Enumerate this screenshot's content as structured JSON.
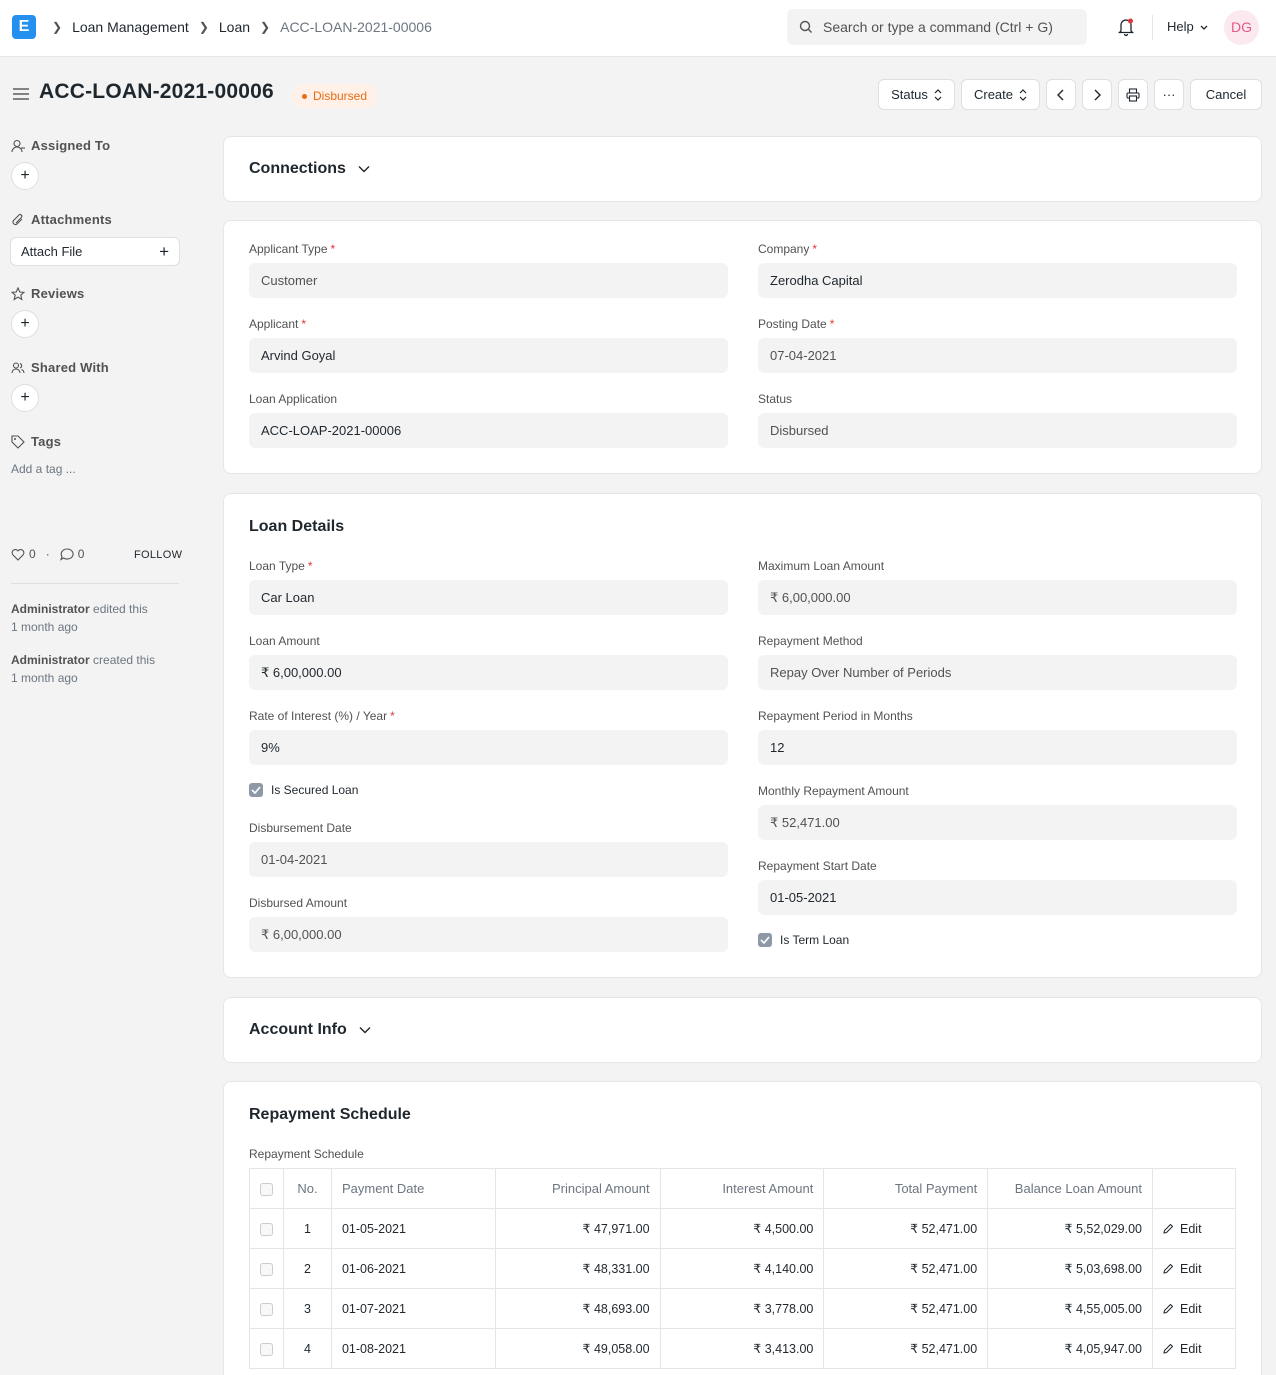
{
  "topbar": {
    "logo": "E",
    "breadcrumbs": [
      "Loan Management",
      "Loan",
      "ACC-LOAN-2021-00006"
    ],
    "search_placeholder": "Search or type a command (Ctrl + G)",
    "help_label": "Help",
    "avatar_initials": "DG"
  },
  "page": {
    "title": "ACC-LOAN-2021-00006",
    "status_badge": "Disbursed",
    "buttons": {
      "status": "Status",
      "create": "Create",
      "more": "···",
      "cancel": "Cancel"
    }
  },
  "sidebar": {
    "assigned_to": "Assigned To",
    "attachments": "Attachments",
    "attach_file": "Attach File",
    "reviews": "Reviews",
    "shared_with": "Shared With",
    "tags": "Tags",
    "add_tag": "Add a tag ...",
    "likes": "0",
    "comments": "0",
    "follow": "FOLLOW",
    "activity": [
      {
        "user": "Administrator",
        "action": "edited this",
        "time": "1 month ago"
      },
      {
        "user": "Administrator",
        "action": "created this",
        "time": "1 month ago"
      }
    ]
  },
  "connections": {
    "title": "Connections"
  },
  "header_fields": {
    "applicant_type": {
      "label": "Applicant Type",
      "value": "Customer"
    },
    "company": {
      "label": "Company",
      "value": "Zerodha Capital"
    },
    "applicant": {
      "label": "Applicant",
      "value": "Arvind Goyal"
    },
    "posting_date": {
      "label": "Posting Date",
      "value": "07-04-2021"
    },
    "loan_application": {
      "label": "Loan Application",
      "value": "ACC-LOAP-2021-00006"
    },
    "status": {
      "label": "Status",
      "value": "Disbursed"
    }
  },
  "loan_details": {
    "title": "Loan Details",
    "loan_type": {
      "label": "Loan Type",
      "value": "Car Loan"
    },
    "loan_amount": {
      "label": "Loan Amount",
      "value": "₹ 6,00,000.00"
    },
    "rate_of_interest": {
      "label": "Rate of Interest (%) / Year",
      "value": "9%"
    },
    "is_secured": {
      "label": "Is Secured Loan",
      "checked": true
    },
    "disbursement_date": {
      "label": "Disbursement Date",
      "value": "01-04-2021"
    },
    "disbursed_amount": {
      "label": "Disbursed Amount",
      "value": "₹ 6,00,000.00"
    },
    "max_loan_amount": {
      "label": "Maximum Loan Amount",
      "value": "₹ 6,00,000.00"
    },
    "repayment_method": {
      "label": "Repayment Method",
      "value": "Repay Over Number of Periods"
    },
    "repayment_period": {
      "label": "Repayment Period in Months",
      "value": "12"
    },
    "monthly_repayment": {
      "label": "Monthly Repayment Amount",
      "value": "₹ 52,471.00"
    },
    "repayment_start": {
      "label": "Repayment Start Date",
      "value": "01-05-2021"
    },
    "is_term_loan": {
      "label": "Is Term Loan",
      "checked": true
    }
  },
  "account_info": {
    "title": "Account Info"
  },
  "repayment_schedule": {
    "title": "Repayment Schedule",
    "table_label": "Repayment Schedule",
    "columns": [
      "No.",
      "Payment Date",
      "Principal Amount",
      "Interest Amount",
      "Total Payment",
      "Balance Loan Amount"
    ],
    "edit_label": "Edit",
    "rows": [
      {
        "no": "1",
        "date": "01-05-2021",
        "principal": "₹ 47,971.00",
        "interest": "₹ 4,500.00",
        "total": "₹ 52,471.00",
        "balance": "₹ 5,52,029.00"
      },
      {
        "no": "2",
        "date": "01-06-2021",
        "principal": "₹ 48,331.00",
        "interest": "₹ 4,140.00",
        "total": "₹ 52,471.00",
        "balance": "₹ 5,03,698.00"
      },
      {
        "no": "3",
        "date": "01-07-2021",
        "principal": "₹ 48,693.00",
        "interest": "₹ 3,778.00",
        "total": "₹ 52,471.00",
        "balance": "₹ 4,55,005.00"
      },
      {
        "no": "4",
        "date": "01-08-2021",
        "principal": "₹ 49,058.00",
        "interest": "₹ 3,413.00",
        "total": "₹ 52,471.00",
        "balance": "₹ 4,05,947.00"
      }
    ]
  },
  "colors": {
    "accent": "#2490ef",
    "status_orange": "#e86c13",
    "required": "#e03636"
  }
}
